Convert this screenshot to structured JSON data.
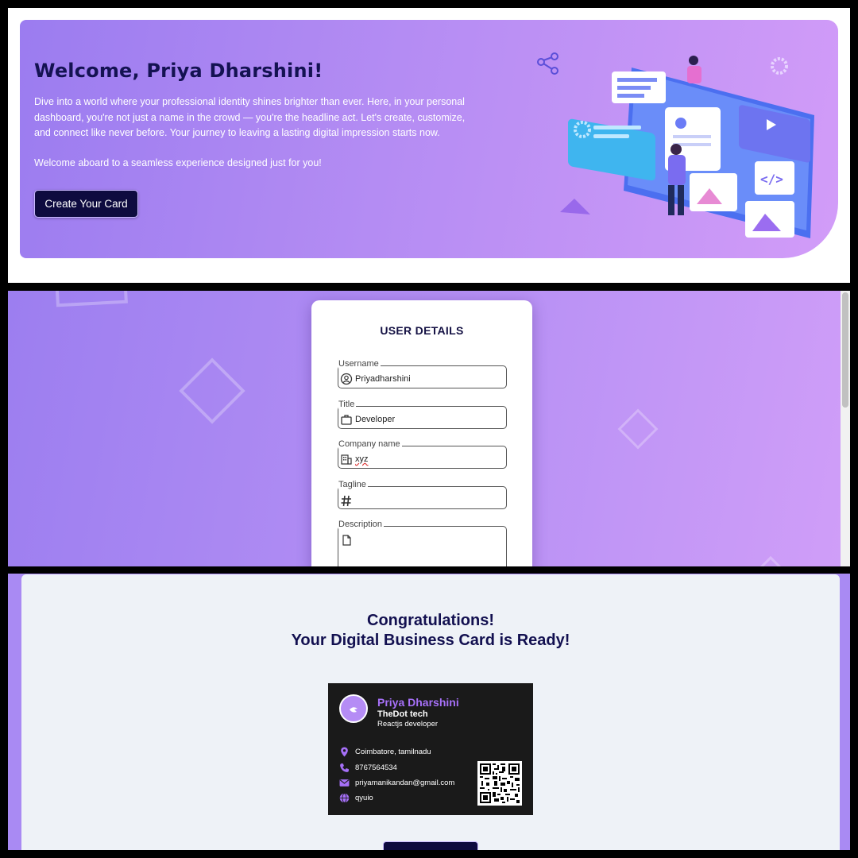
{
  "welcome": {
    "title": "Welcome, Priya Dharshini!",
    "paragraph": "Dive into a world where your professional identity shines brighter than ever. Here, in your personal dashboard, you're not just a name in the crowd — you're the headline act. Let's create, customize, and connect like never before. Your journey to leaving a lasting digital impression starts now.",
    "paragraph2": "Welcome aboard to a seamless experience designed just for you!",
    "cta_label": "Create Your Card"
  },
  "form": {
    "title": "USER DETAILS",
    "fields": [
      {
        "label": "Username",
        "value": "Priyadharshini",
        "icon": "user-circle-icon"
      },
      {
        "label": "Title",
        "value": "Developer",
        "icon": "briefcase-icon"
      },
      {
        "label": "Company name",
        "value": "xyz",
        "icon": "building-icon"
      },
      {
        "label": "Tagline",
        "value": "",
        "icon": "hash-icon"
      },
      {
        "label": "Description",
        "value": "",
        "icon": "document-icon"
      }
    ]
  },
  "result": {
    "heading_line1": "Congratulations!",
    "heading_line2": "Your Digital Business Card is Ready!",
    "card": {
      "name": "Priya Dharshini",
      "company": "TheDot tech",
      "role": "Reactjs developer",
      "location": "Coimbatore, tamilnadu",
      "phone": "8767564534",
      "email": "priyamanikandan@gmail.com",
      "website": "qyuio"
    }
  },
  "colors": {
    "accent_purple": "#a670f8",
    "navy": "#121050",
    "card_bg": "#1a1a1a"
  }
}
